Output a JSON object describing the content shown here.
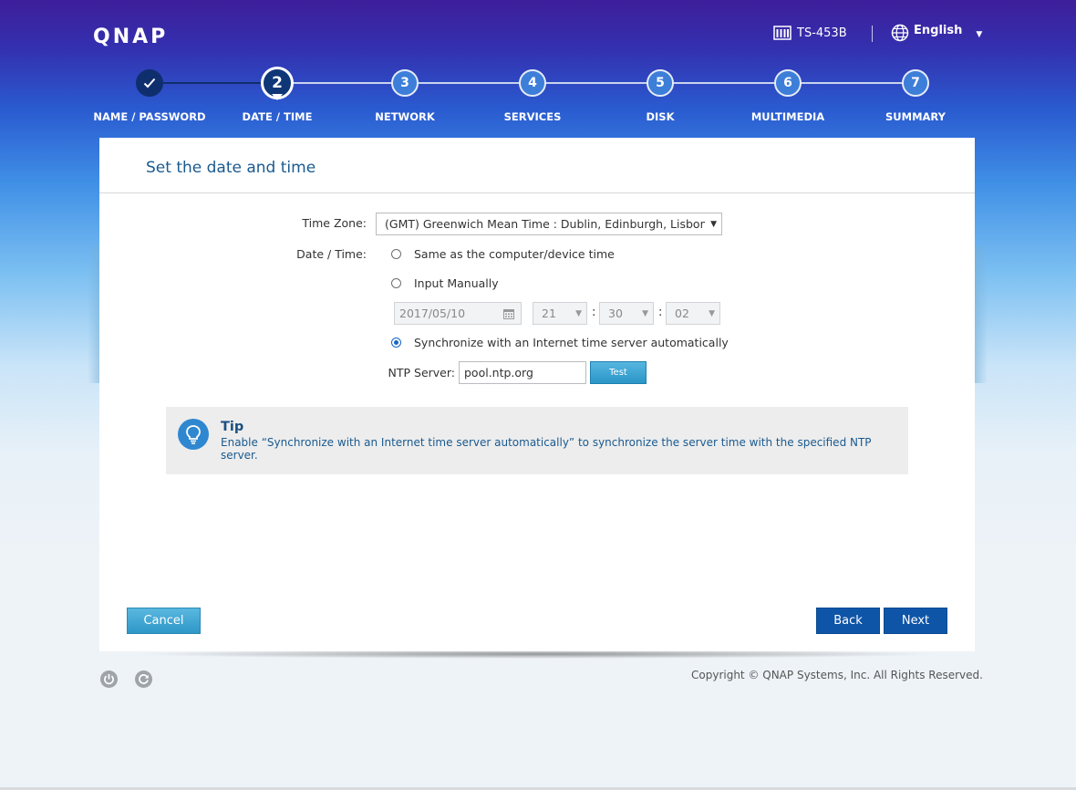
{
  "header": {
    "logo": "QNAP",
    "device_name": "TS-453B",
    "language": "English"
  },
  "steps": [
    {
      "number": "✓",
      "label": "NAME / PASSWORD",
      "state": "done"
    },
    {
      "number": "2",
      "label": "DATE / TIME",
      "state": "active"
    },
    {
      "number": "3",
      "label": "NETWORK",
      "state": "pending"
    },
    {
      "number": "4",
      "label": "SERVICES",
      "state": "pending"
    },
    {
      "number": "5",
      "label": "DISK",
      "state": "pending"
    },
    {
      "number": "6",
      "label": "MULTIMEDIA",
      "state": "pending"
    },
    {
      "number": "7",
      "label": "SUMMARY",
      "state": "pending"
    }
  ],
  "page": {
    "title": "Set the date and time"
  },
  "form": {
    "time_zone_label": "Time Zone:",
    "time_zone_value": "(GMT) Greenwich Mean Time : Dublin, Edinburgh, Lisbon, London",
    "date_time_label": "Date / Time:",
    "option_same": "Same as the computer/device time",
    "option_manual": "Input Manually",
    "option_sync": "Synchronize with an Internet time server automatically",
    "selected_option": "sync",
    "manual_date": "2017/05/10",
    "manual_hour": "21",
    "manual_minute": "30",
    "manual_second": "02",
    "ntp_label": "NTP Server:",
    "ntp_value": "pool.ntp.org",
    "test_label": "Test"
  },
  "tip": {
    "title": "Tip",
    "text": "Enable “Synchronize with an Internet time server automatically” to synchronize the server time with the specified NTP server."
  },
  "buttons": {
    "cancel": "Cancel",
    "back": "Back",
    "next": "Next"
  },
  "footer": {
    "copyright": "Copyright © QNAP Systems, Inc. All Rights Reserved."
  },
  "colors": {
    "accent": "#0e55a8",
    "title": "#1a5a8f",
    "tip_bg": "#ededed"
  }
}
